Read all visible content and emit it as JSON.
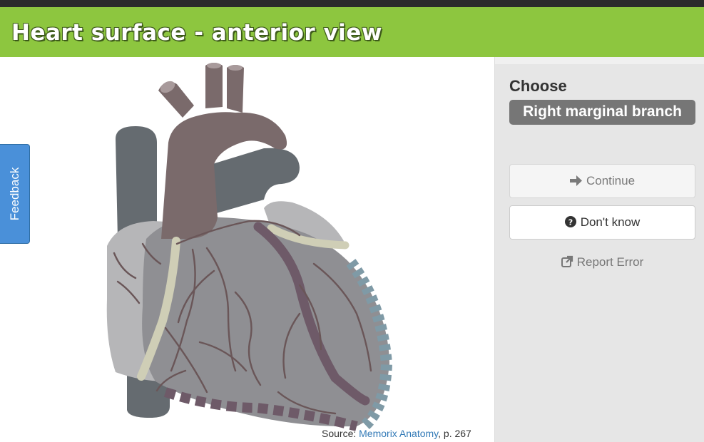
{
  "header": {
    "title": "Heart surface - anterior view"
  },
  "feedback": {
    "label": "Feedback"
  },
  "source": {
    "prefix": "Source: ",
    "link_text": "Memorix Anatomy",
    "suffix": ", p. 267"
  },
  "quiz": {
    "choose_label": "Choose",
    "target_structure": "Right marginal branch",
    "continue_label": "Continue",
    "dont_know_label": "Don't know",
    "report_error_label": "Report Error"
  },
  "icons": {
    "continue": "arrow-right-icon",
    "dont_know": "question-circle-icon",
    "report_error": "external-link-icon"
  },
  "colors": {
    "header_green": "#8dc63f",
    "top_bar": "#2b2b2b",
    "feedback_blue": "#4a90d9",
    "target_badge": "#767676",
    "link_blue": "#337ab7"
  }
}
